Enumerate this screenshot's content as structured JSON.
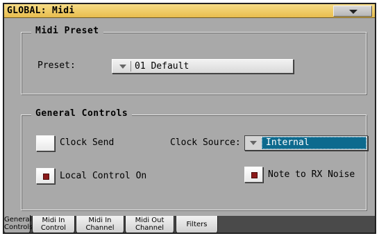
{
  "window": {
    "title": "GLOBAL: Midi",
    "menu_icon": "triangle-down"
  },
  "midi_preset": {
    "group_label": "Midi Preset",
    "preset_label": "Preset:",
    "preset_value": "01 Default"
  },
  "general_controls": {
    "group_label": "General Controls",
    "clock_send": {
      "label": "Clock Send",
      "checked": false
    },
    "clock_source": {
      "label": "Clock Source:",
      "value": "Internal"
    },
    "local_control_on": {
      "label": "Local Control On",
      "checked": true
    },
    "note_to_rx_noise": {
      "label": "Note to RX Noise",
      "checked": true
    }
  },
  "tabs": [
    {
      "line1": "General",
      "line2": "Controls",
      "active": true
    },
    {
      "line1": "Midi In",
      "line2": "Control",
      "active": false
    },
    {
      "line1": "Midi In",
      "line2": "Channel",
      "active": false
    },
    {
      "line1": "Midi Out",
      "line2": "Channel",
      "active": false
    },
    {
      "line1": "Filters",
      "line2": "",
      "active": false
    }
  ],
  "colors": {
    "title_bar": "#e8bd4e",
    "panel_bg": "#a9a9a9",
    "selection": "#0d6a8e",
    "check_mark": "#8b1a1a"
  }
}
